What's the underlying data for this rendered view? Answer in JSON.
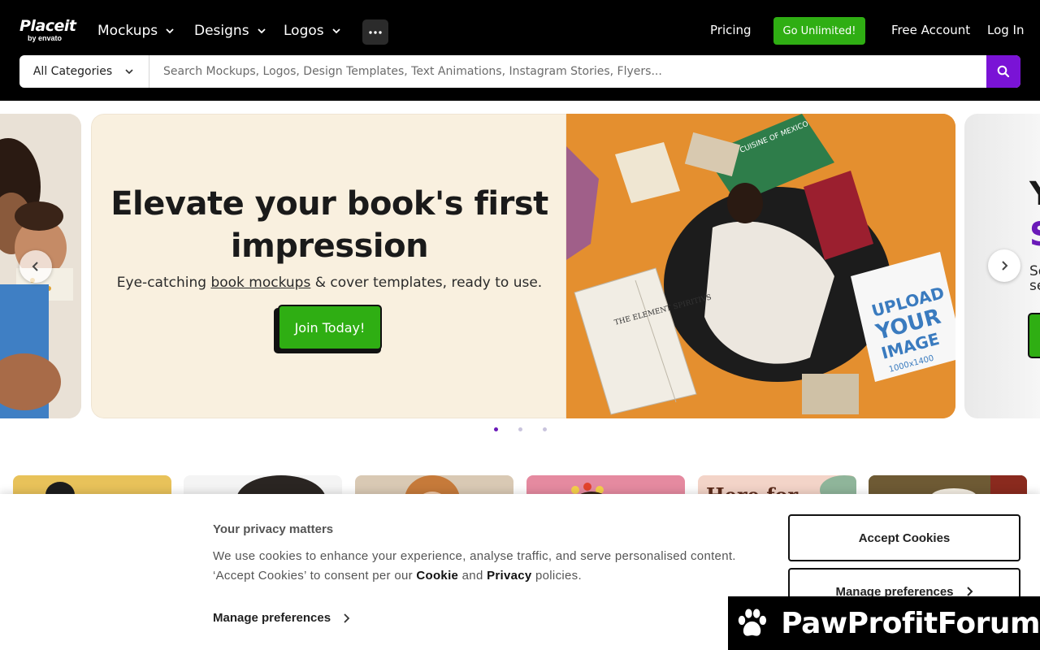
{
  "header": {
    "logo_main": "Placeit",
    "logo_sub": "by envato",
    "nav": [
      {
        "label": "Mockups"
      },
      {
        "label": "Designs"
      },
      {
        "label": "Logos"
      }
    ],
    "more_icon": "ellipsis-icon",
    "pricing": "Pricing",
    "go_unlimited": "Go Unlimited!",
    "free_account": "Free Account",
    "login": "Log In",
    "brand_color": "#2fae13",
    "accent_color": "#7a13d6"
  },
  "search": {
    "category": "All Categories",
    "placeholder": "Search Mockups, Logos, Design Templates, Text Animations, Instagram Stories, Flyers...",
    "value": "",
    "icon": "search-icon"
  },
  "hero": {
    "title": "Elevate your book's first impression",
    "subtitle_pre": "Eye-catching ",
    "subtitle_link": "book mockups",
    "subtitle_post": " & cover templates, ready to use.",
    "cta": "Join Today!",
    "image_text_upload": "UPLOAD",
    "image_text_your": "YOUR",
    "image_text_image": "IMAGE",
    "image_text_size": "1000x1400",
    "book_title_1": "THE ELEMENT SPIRITIVS",
    "book_title_2": "CUISINE OF MEXICO",
    "slides_total": 3,
    "active_slide": 1,
    "right_card_chars": [
      "Y",
      "S",
      "Se",
      "se"
    ]
  },
  "cookie": {
    "title": "Your privacy matters",
    "text_1": "We use cookies to enhance your experience, analyse traffic, and serve personalised content. ‘Accept Cookies’ to consent per our ",
    "cookie_link": "Cookie",
    "and": " and ",
    "privacy_link": "Privacy",
    "text_2": " policies.",
    "manage": "Manage preferences",
    "accept_button": "Accept Cookies",
    "manage_button": "Manage preferences"
  },
  "thumbnails": [
    {
      "label": "",
      "color": "#e8c25a"
    },
    {
      "label": "",
      "color": "#f4f4f4"
    },
    {
      "label": "",
      "color": "#d9c9b4"
    },
    {
      "label": "",
      "color": "#e58aa0"
    },
    {
      "label": "Here for",
      "color": "#f3d4c8"
    },
    {
      "label": "",
      "color": "#5a6a3a"
    }
  ],
  "watermark": "PawProfitForum"
}
